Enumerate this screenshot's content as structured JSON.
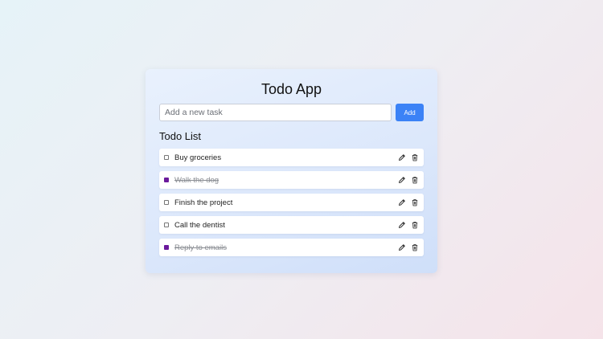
{
  "app": {
    "title": "Todo App"
  },
  "add_form": {
    "placeholder": "Add a new task",
    "value": "",
    "button_label": "Add"
  },
  "list": {
    "heading": "Todo List",
    "items": [
      {
        "text": "Buy groceries",
        "completed": false
      },
      {
        "text": "Walk the dog",
        "completed": true
      },
      {
        "text": "Finish the project",
        "completed": false
      },
      {
        "text": "Call the dentist",
        "completed": false
      },
      {
        "text": "Reply to emails",
        "completed": true
      }
    ]
  },
  "icons": {
    "edit": "pencil-icon",
    "delete": "trash-icon"
  },
  "colors": {
    "accent": "#3b82f6",
    "checkbox_checked": "#6b1a9c"
  }
}
